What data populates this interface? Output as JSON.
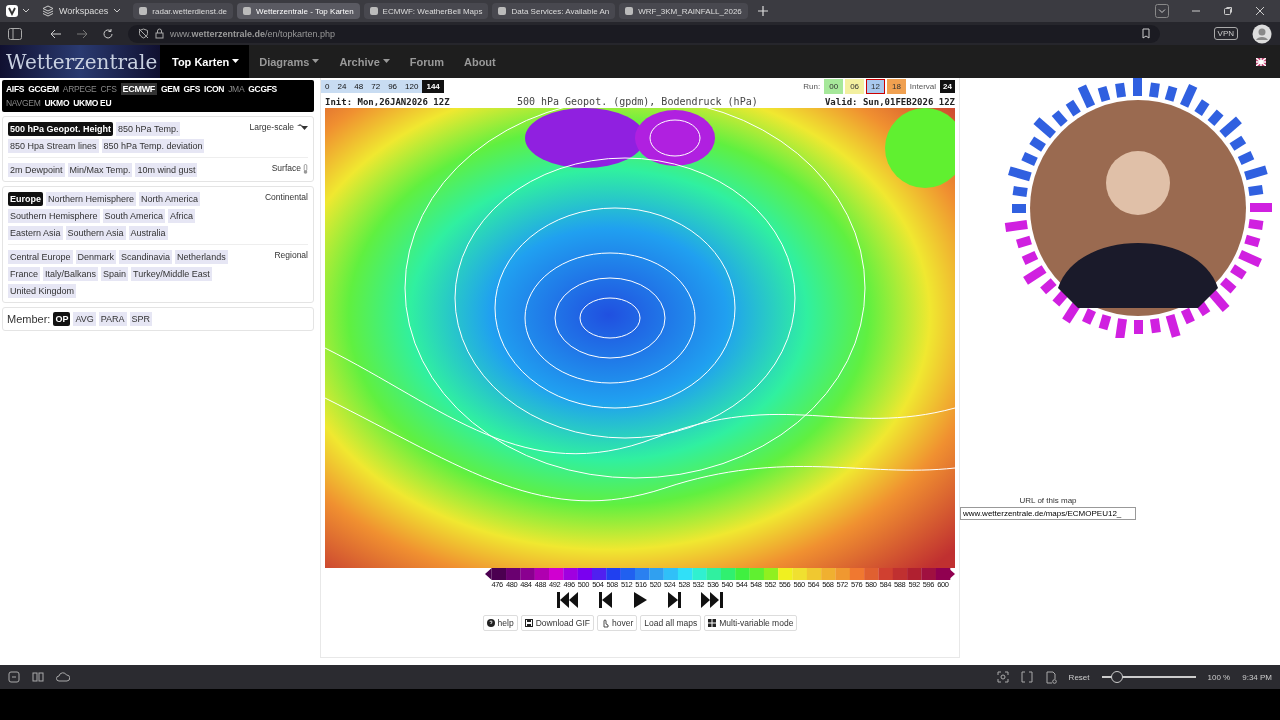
{
  "browser": {
    "workspaces": "Workspaces",
    "tabs": [
      {
        "title": "radar.wetterdienst.de",
        "selected": false
      },
      {
        "title": "Wetterzentrale - Top Karten",
        "selected": true
      },
      {
        "title": "ECMWF: WeatherBell Maps",
        "selected": false
      },
      {
        "title": "Data Services: Available An",
        "selected": false
      },
      {
        "title": "WRF_3KM_RAINFALL_2026",
        "selected": false
      }
    ],
    "url": "www.**wetterzentrale.de**/en/topkarten.php",
    "vpn": "VPN"
  },
  "site": {
    "logo": "Wetterzentrale",
    "nav": [
      {
        "label": "Top Karten",
        "selected": true,
        "dropdown": true
      },
      {
        "label": "Diagrams",
        "selected": false,
        "dropdown": true
      },
      {
        "label": "Archive",
        "selected": false,
        "dropdown": true
      },
      {
        "label": "Forum",
        "selected": false,
        "dropdown": false
      },
      {
        "label": "About",
        "selected": false,
        "dropdown": false
      }
    ]
  },
  "models": [
    {
      "label": "AIFS",
      "selected": false,
      "disabled": false
    },
    {
      "label": "GCGEM",
      "selected": false,
      "disabled": false
    },
    {
      "label": "ARPEGE",
      "selected": false,
      "disabled": true
    },
    {
      "label": "CFS",
      "selected": false,
      "disabled": true
    },
    {
      "label": "ECMWF",
      "selected": true,
      "disabled": false
    },
    {
      "label": "GEM",
      "selected": false,
      "disabled": false
    },
    {
      "label": "GFS",
      "selected": false,
      "disabled": false
    },
    {
      "label": "ICON",
      "selected": false,
      "disabled": false
    },
    {
      "label": "JMA",
      "selected": false,
      "disabled": true
    },
    {
      "label": "GCGFS",
      "selected": false,
      "disabled": false
    },
    {
      "label": "NAVGEM",
      "selected": false,
      "disabled": true
    },
    {
      "label": "UKMO",
      "selected": false,
      "disabled": false
    },
    {
      "label": "UKMO EU",
      "selected": false,
      "disabled": false
    }
  ],
  "cards": [
    {
      "sections": [
        {
          "label": "Large-scale",
          "kind": "collapse",
          "items": [
            {
              "label": "500 hPa Geopot. Height",
              "selected": true
            },
            {
              "label": "850 hPa Temp.",
              "selected": false
            },
            {
              "label": "850 Hpa Stream lines",
              "selected": false
            },
            {
              "label": "850 hPa Temp. deviation",
              "selected": false
            }
          ]
        },
        {
          "label": "Surface",
          "kind": "thermometer",
          "items": [
            {
              "label": "2m Dewpoint",
              "selected": false
            },
            {
              "label": "Min/Max Temp.",
              "selected": false
            },
            {
              "label": "10m wind gust",
              "selected": false
            }
          ]
        }
      ]
    },
    {
      "sections": [
        {
          "label": "Continental",
          "kind": "plain",
          "items": [
            {
              "label": "Europe",
              "selected": true
            },
            {
              "label": "Northern Hemisphere",
              "selected": false
            },
            {
              "label": "North America",
              "selected": false
            },
            {
              "label": "Southern Hemisphere",
              "selected": false
            },
            {
              "label": "South America",
              "selected": false
            },
            {
              "label": "Africa",
              "selected": false
            },
            {
              "label": "Eastern Asia",
              "selected": false
            },
            {
              "label": "Southern Asia",
              "selected": false
            },
            {
              "label": "Australia",
              "selected": false
            }
          ]
        },
        {
          "label": "Regional",
          "kind": "plain",
          "items": [
            {
              "label": "Central Europe",
              "selected": false
            },
            {
              "label": "Denmark",
              "selected": false
            },
            {
              "label": "Scandinavia",
              "selected": false
            },
            {
              "label": "Netherlands",
              "selected": false
            },
            {
              "label": "France",
              "selected": false
            },
            {
              "label": "Italy/Balkans",
              "selected": false
            },
            {
              "label": "Spain",
              "selected": false
            },
            {
              "label": "Turkey/Middle East",
              "selected": false
            },
            {
              "label": "United Kingdom",
              "selected": false
            }
          ]
        }
      ]
    }
  ],
  "member": {
    "label": "Member:",
    "options": [
      {
        "label": "OP",
        "selected": true
      },
      {
        "label": "AVG",
        "selected": false
      },
      {
        "label": "PARA",
        "selected": false
      },
      {
        "label": "SPR",
        "selected": false
      }
    ]
  },
  "map": {
    "hours": [
      {
        "label": "0",
        "selected": false
      },
      {
        "label": "24",
        "selected": false
      },
      {
        "label": "48",
        "selected": false
      },
      {
        "label": "72",
        "selected": false
      },
      {
        "label": "96",
        "selected": false
      },
      {
        "label": "120",
        "selected": false
      },
      {
        "label": "144",
        "selected": true
      }
    ],
    "run_label": "Run:",
    "runs": [
      {
        "label": "00",
        "color": "#a6e89a",
        "selected": false
      },
      {
        "label": "06",
        "color": "#f3f0a0",
        "selected": false
      },
      {
        "label": "12",
        "color": "#a9c8ee",
        "selected": true
      },
      {
        "label": "18",
        "color": "#f0a050",
        "selected": false
      }
    ],
    "interval_label": "Interval",
    "interval": "24",
    "init": "Init: Mon,26JAN2026 12Z",
    "title": "500 hPa Geopot. (gpdm), Bodendruck (hPa)",
    "valid": "Valid: Sun,01FEB2026 12Z",
    "colorbar": [
      "476",
      "480",
      "484",
      "488",
      "492",
      "496",
      "500",
      "504",
      "508",
      "512",
      "516",
      "520",
      "524",
      "528",
      "532",
      "536",
      "540",
      "544",
      "548",
      "552",
      "556",
      "560",
      "564",
      "568",
      "572",
      "576",
      "580",
      "584",
      "588",
      "592",
      "596",
      "600"
    ],
    "tools": [
      "help",
      "Download GIF",
      "hover",
      "Load all maps",
      "Multi-variable mode"
    ]
  },
  "url_box": {
    "caption": "URL of this map",
    "value": "www.wetterzentrale.de/maps/ECMOPEU12_"
  },
  "status_bar": {
    "reset": "Reset",
    "level": 0.17,
    "zoom": "100 %",
    "time": "9:34 PM"
  }
}
